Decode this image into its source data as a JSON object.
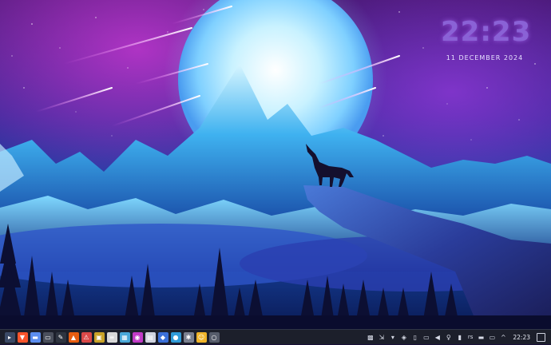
{
  "desktop": {
    "clock_widget": {
      "time": "22:23",
      "date": "11 DECEMBER 2024"
    }
  },
  "taskbar": {
    "left_icons": [
      {
        "name": "app-menu-icon",
        "glyph": "▸",
        "color": "#3b4a66"
      },
      {
        "name": "brave-browser-icon",
        "glyph": "▼",
        "color": "#fb542b"
      },
      {
        "name": "files-icon",
        "glyph": "▬",
        "color": "#5b8def"
      },
      {
        "name": "terminal-icon",
        "glyph": "▭",
        "color": "#4a4f5c"
      },
      {
        "name": "editor-icon",
        "glyph": "✎",
        "color": "#2e3440"
      },
      {
        "name": "vlc-icon",
        "glyph": "▲",
        "color": "#e85d10"
      },
      {
        "name": "warning-app-icon",
        "glyph": "⚠",
        "color": "#d94848"
      },
      {
        "name": "image-viewer-icon",
        "glyph": "▣",
        "color": "#c9a227"
      },
      {
        "name": "document-viewer-icon",
        "glyph": "≡",
        "color": "#d8d8d8"
      },
      {
        "name": "monitor-icon",
        "glyph": "▦",
        "color": "#4aa8d8"
      },
      {
        "name": "camera-app-icon",
        "glyph": "◉",
        "color": "#c23ac7"
      },
      {
        "name": "notes-app-icon",
        "glyph": "▤",
        "color": "#cfd3df"
      },
      {
        "name": "shield-app-icon",
        "glyph": "◆",
        "color": "#3a6fd8"
      },
      {
        "name": "chat-app-icon",
        "glyph": "●",
        "color": "#2f9bd9"
      },
      {
        "name": "settings-app-icon",
        "glyph": "✱",
        "color": "#7a8090"
      },
      {
        "name": "emoji-app-icon",
        "glyph": "☺",
        "color": "#f0b429"
      },
      {
        "name": "extra-app-icon",
        "glyph": "○",
        "color": "#565c6b"
      }
    ],
    "tray": {
      "icons_before": [
        {
          "name": "qr-tray-icon",
          "glyph": "▩"
        },
        {
          "name": "pointer-tray-icon",
          "glyph": "⇲"
        },
        {
          "name": "network-tray-icon",
          "glyph": "▾"
        },
        {
          "name": "shield-tray-icon",
          "glyph": "◈"
        },
        {
          "name": "clipboard-tray-icon",
          "glyph": "▯"
        },
        {
          "name": "display-tray-icon",
          "glyph": "▭"
        },
        {
          "name": "volume-tray-icon",
          "glyph": "◀"
        },
        {
          "name": "lightbulb-tray-icon",
          "glyph": "♀"
        },
        {
          "name": "keyboard-tray-icon",
          "glyph": "▮"
        }
      ],
      "keyboard_layout": "rs",
      "icons_after": [
        {
          "name": "battery-tray-icon",
          "glyph": "▬"
        },
        {
          "name": "screen-tray-icon",
          "glyph": "▭"
        },
        {
          "name": "expand-tray-icon",
          "glyph": "^"
        }
      ],
      "clock": "22:23"
    }
  }
}
